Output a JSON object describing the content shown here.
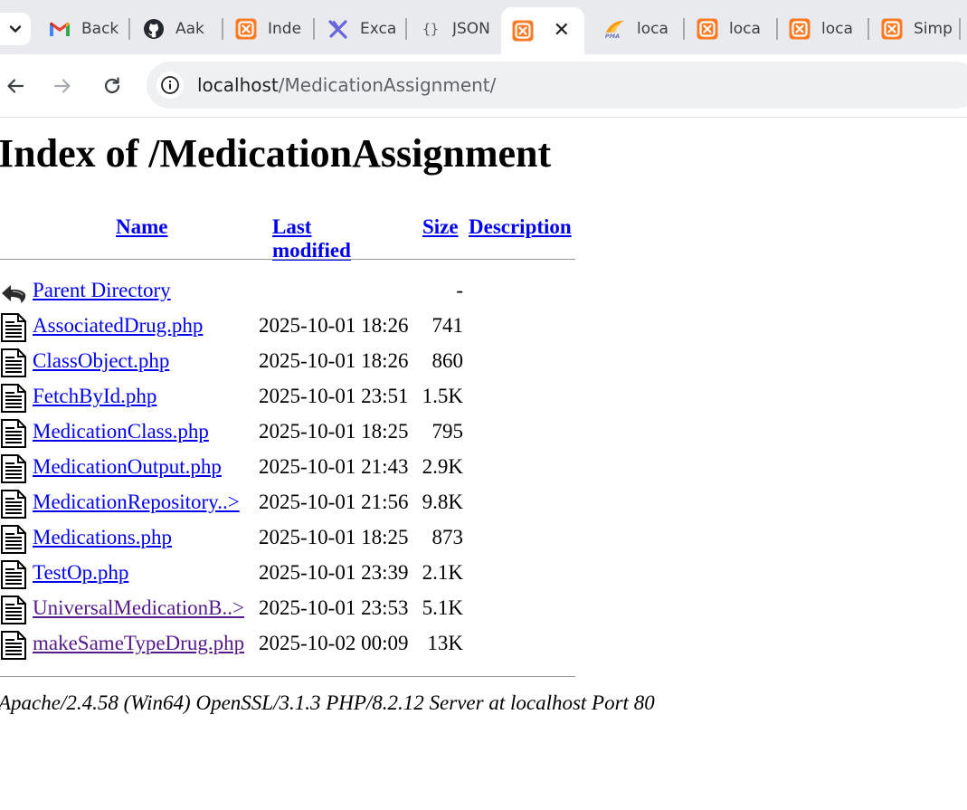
{
  "browser": {
    "tabs": [
      {
        "label": "Back",
        "icon": "gmail-icon"
      },
      {
        "label": "Aak",
        "icon": "github-icon"
      },
      {
        "label": "Inde",
        "icon": "xampp-icon"
      },
      {
        "label": "Exca",
        "icon": "excalidraw-icon"
      },
      {
        "label": "JSON",
        "icon": "json-icon"
      },
      {
        "label": "",
        "icon": "xampp-icon",
        "active": true
      },
      {
        "label": "loca",
        "icon": "phpmyadmin-icon"
      },
      {
        "label": "loca",
        "icon": "xampp-icon"
      },
      {
        "label": "loca",
        "icon": "xampp-icon"
      },
      {
        "label": "Simp",
        "icon": "xampp-icon"
      }
    ],
    "url_host": "localhost",
    "url_path": "/MedicationAssignment/"
  },
  "page": {
    "title": "Index of /MedicationAssignment",
    "columns": {
      "name": "Name",
      "last_modified": "Last modified",
      "size": "Size",
      "description": "Description"
    },
    "parent": {
      "label": "Parent Directory",
      "size": "-"
    },
    "files": [
      {
        "name": "AssociatedDrug.php",
        "modified": "2025-10-01 18:26",
        "size": "741",
        "visited": false
      },
      {
        "name": "ClassObject.php",
        "modified": "2025-10-01 18:26",
        "size": "860",
        "visited": false
      },
      {
        "name": "FetchById.php",
        "modified": "2025-10-01 23:51",
        "size": "1.5K",
        "visited": false
      },
      {
        "name": "MedicationClass.php",
        "modified": "2025-10-01 18:25",
        "size": "795",
        "visited": false
      },
      {
        "name": "MedicationOutput.php",
        "modified": "2025-10-01 21:43",
        "size": "2.9K",
        "visited": false
      },
      {
        "name": "MedicationRepository..>",
        "modified": "2025-10-01 21:56",
        "size": "9.8K",
        "visited": false
      },
      {
        "name": "Medications.php",
        "modified": "2025-10-01 18:25",
        "size": "873",
        "visited": false
      },
      {
        "name": "TestOp.php",
        "modified": "2025-10-01 23:39",
        "size": "2.1K",
        "visited": false
      },
      {
        "name": "UniversalMedicationB..>",
        "modified": "2025-10-01 23:53",
        "size": "5.1K",
        "visited": true
      },
      {
        "name": "makeSameTypeDrug.php",
        "modified": "2025-10-02 00:09",
        "size": "13K",
        "visited": true
      }
    ],
    "server_signature": "Apache/2.4.58 (Win64) OpenSSL/3.1.3 PHP/8.2.12 Server at localhost Port 80"
  },
  "colors": {
    "link": "#0000ee",
    "visited_link": "#551a8b",
    "tabstrip_bg": "#e8eaed",
    "omnibox_bg": "#eef0f2",
    "xampp_orange": "#fb7a24"
  }
}
